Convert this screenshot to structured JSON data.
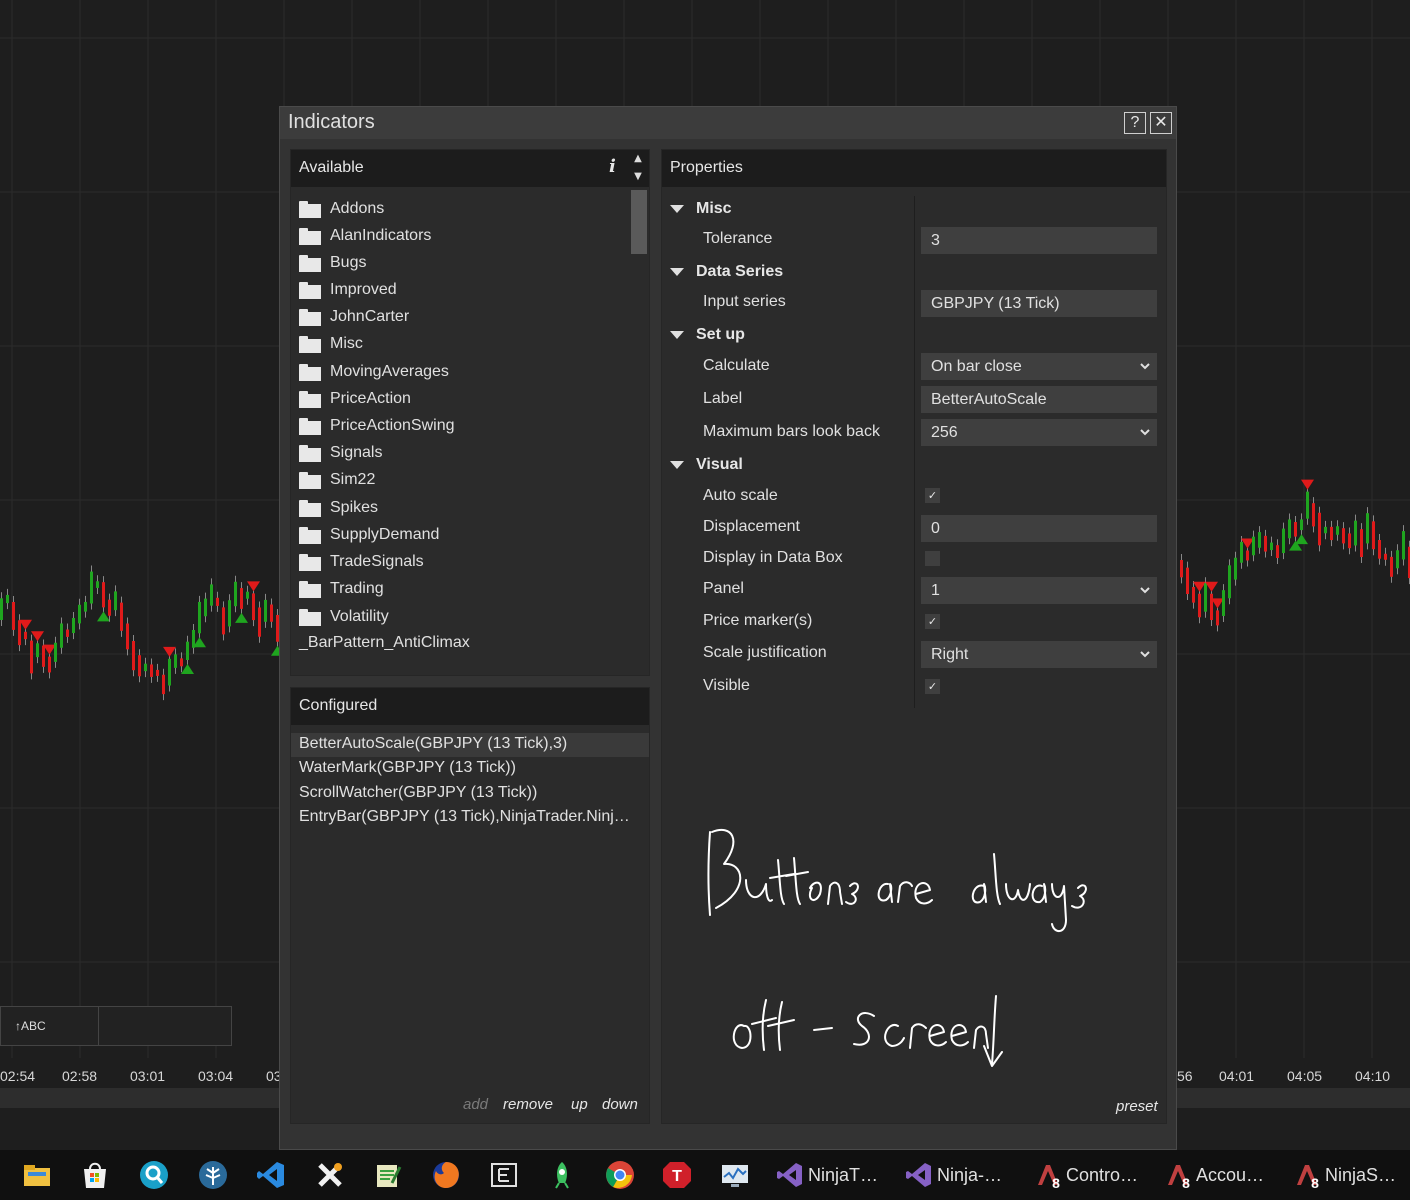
{
  "chart": {
    "time_labels_left": [
      "02:54",
      "02:58",
      "03:01",
      "03:04",
      "03"
    ],
    "time_labels_right": [
      "56",
      "04:01",
      "04:05",
      "04:10"
    ],
    "drawing_tool_label": "↑ABC"
  },
  "dialog": {
    "title": "Indicators",
    "help_label": "?",
    "close_label": "✕"
  },
  "available": {
    "header": "Available",
    "info_label": "i",
    "folders": [
      "Addons",
      "AlanIndicators",
      "Bugs",
      "Improved",
      "JohnCarter",
      "Misc",
      "MovingAverages",
      "PriceAction",
      "PriceActionSwing",
      "Signals",
      "Sim22",
      "Spikes",
      "SupplyDemand",
      "TradeSignals",
      "Trading",
      "Volatility"
    ],
    "items": [
      "_BarPattern_AntiClimax"
    ]
  },
  "configured": {
    "header": "Configured",
    "items": [
      "BetterAutoScale(GBPJPY (13 Tick),3)",
      "WaterMark(GBPJPY (13 Tick))",
      "ScrollWatcher(GBPJPY (13 Tick))",
      "EntryBar(GBPJPY (13 Tick),NinjaTrader.Ninj…"
    ],
    "actions": {
      "add": "add",
      "remove": "remove",
      "up": "up",
      "down": "down"
    }
  },
  "properties": {
    "header": "Properties",
    "categories": {
      "misc": "Misc",
      "data_series": "Data Series",
      "set_up": "Set up",
      "visual": "Visual"
    },
    "rows": {
      "tolerance": {
        "label": "Tolerance",
        "value": "3"
      },
      "input_series": {
        "label": "Input series",
        "value": "GBPJPY (13 Tick)"
      },
      "calculate": {
        "label": "Calculate",
        "value": "On bar close"
      },
      "label": {
        "label": "Label",
        "value": "BetterAutoScale"
      },
      "max_bars": {
        "label": "Maximum bars look back",
        "value": "256"
      },
      "auto_scale": {
        "label": "Auto scale",
        "checked": true
      },
      "displacement": {
        "label": "Displacement",
        "value": "0"
      },
      "display_in_data_box": {
        "label": "Display in Data Box",
        "checked": false
      },
      "panel": {
        "label": "Panel",
        "value": "1"
      },
      "price_markers": {
        "label": "Price marker(s)",
        "checked": true
      },
      "scale_justification": {
        "label": "Scale justification",
        "value": "Right"
      },
      "visible": {
        "label": "Visible",
        "checked": true
      }
    },
    "preset_label": "preset",
    "handwritten_note": "Buttons are always off - screen"
  },
  "taskbar": {
    "apps": [
      {
        "label": "NinjaT…",
        "icon": "visual-studio-icon"
      },
      {
        "label": "Ninja-…",
        "icon": "visual-studio-icon"
      },
      {
        "label": "Contro…",
        "icon": "ninjatrader-icon"
      },
      {
        "label": "Accou…",
        "icon": "ninjatrader-icon"
      },
      {
        "label": "NinjaS…",
        "icon": "ninjatrader-icon"
      }
    ]
  },
  "colors": {
    "bull": "#1fa51f",
    "bear": "#e01a1a",
    "dialog_bg": "#333333",
    "panel_bg": "#2b2b2b",
    "header_bg": "#1c1c1c",
    "field_bg": "#3f3f3f"
  }
}
